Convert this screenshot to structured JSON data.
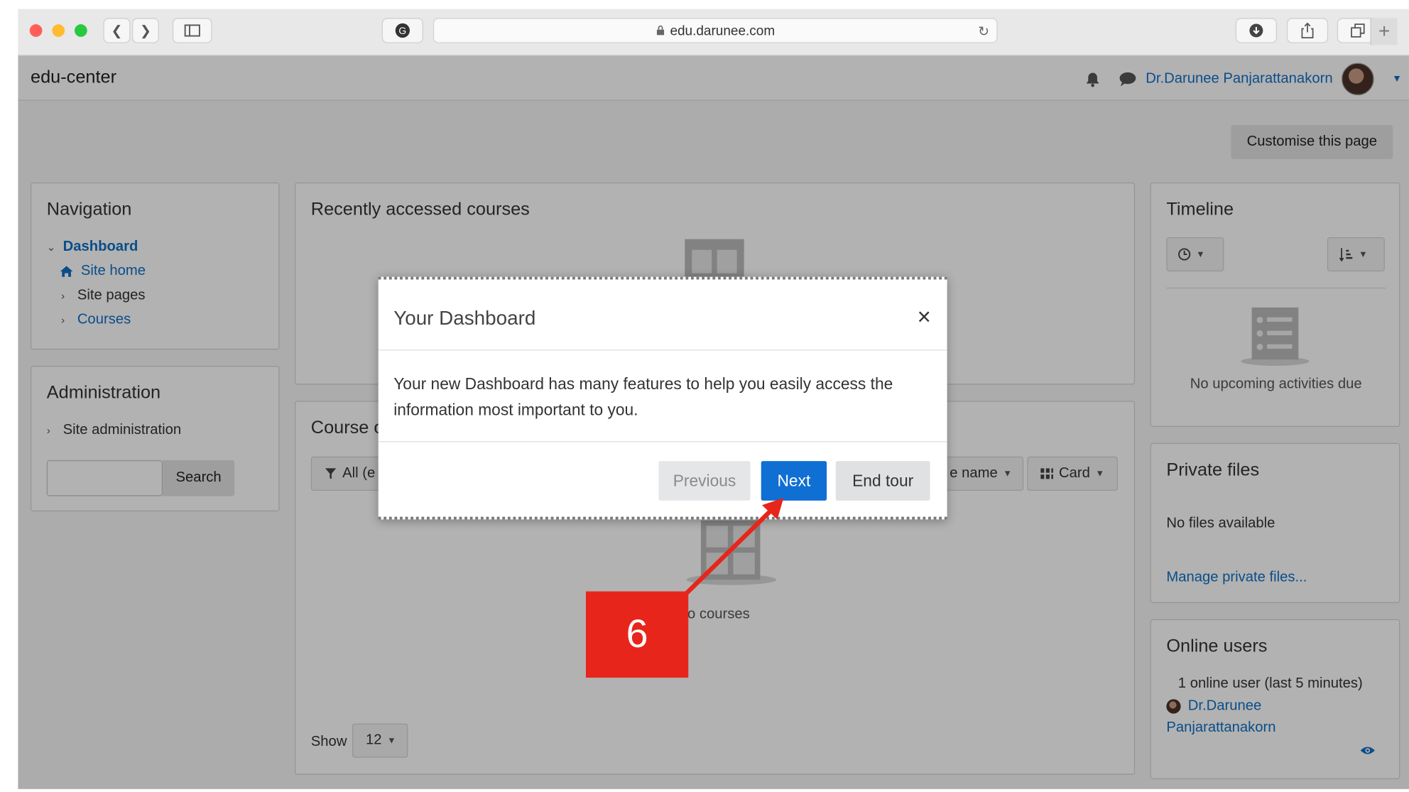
{
  "browser": {
    "url": "edu.darunee.com",
    "accent_colors": {
      "close": "#ff5f57",
      "minimize": "#febc2e",
      "maximize": "#28c840"
    }
  },
  "navbar": {
    "brand": "edu-center",
    "user_name": "Dr.Darunee Panjarattanakorn"
  },
  "customise_button": "Customise this page",
  "navigation": {
    "title": "Navigation",
    "items": [
      "Dashboard",
      "Site home",
      "Site pages",
      "Courses"
    ]
  },
  "administration": {
    "title": "Administration",
    "item": "Site administration",
    "search_button": "Search",
    "search_value": ""
  },
  "recent_courses": {
    "title": "Recently accessed courses"
  },
  "course_overview": {
    "title": "Course o",
    "filter_label": "All (e",
    "sort_label": "e name",
    "view_label": "Card",
    "empty_text": "o courses",
    "show_label": "Show",
    "show_value": "12"
  },
  "timeline": {
    "title": "Timeline",
    "empty_text": "No upcoming activities due"
  },
  "private_files": {
    "title": "Private files",
    "empty_text": "No files available",
    "manage_link": "Manage private files..."
  },
  "online_users": {
    "title": "Online users",
    "summary": "1 online user (last 5 minutes)",
    "user_line1": "Dr.Darunee",
    "user_line2": "Panjarattanakorn"
  },
  "tour_dialog": {
    "title": "Your Dashboard",
    "close_symbol": "×",
    "body": "Your new Dashboard has many features to help you easily access the information most important to you.",
    "previous_button": "Previous",
    "next_button": "Next",
    "end_tour_button": "End tour"
  },
  "annotation": {
    "step_number": "6",
    "color": "#e8251a"
  }
}
